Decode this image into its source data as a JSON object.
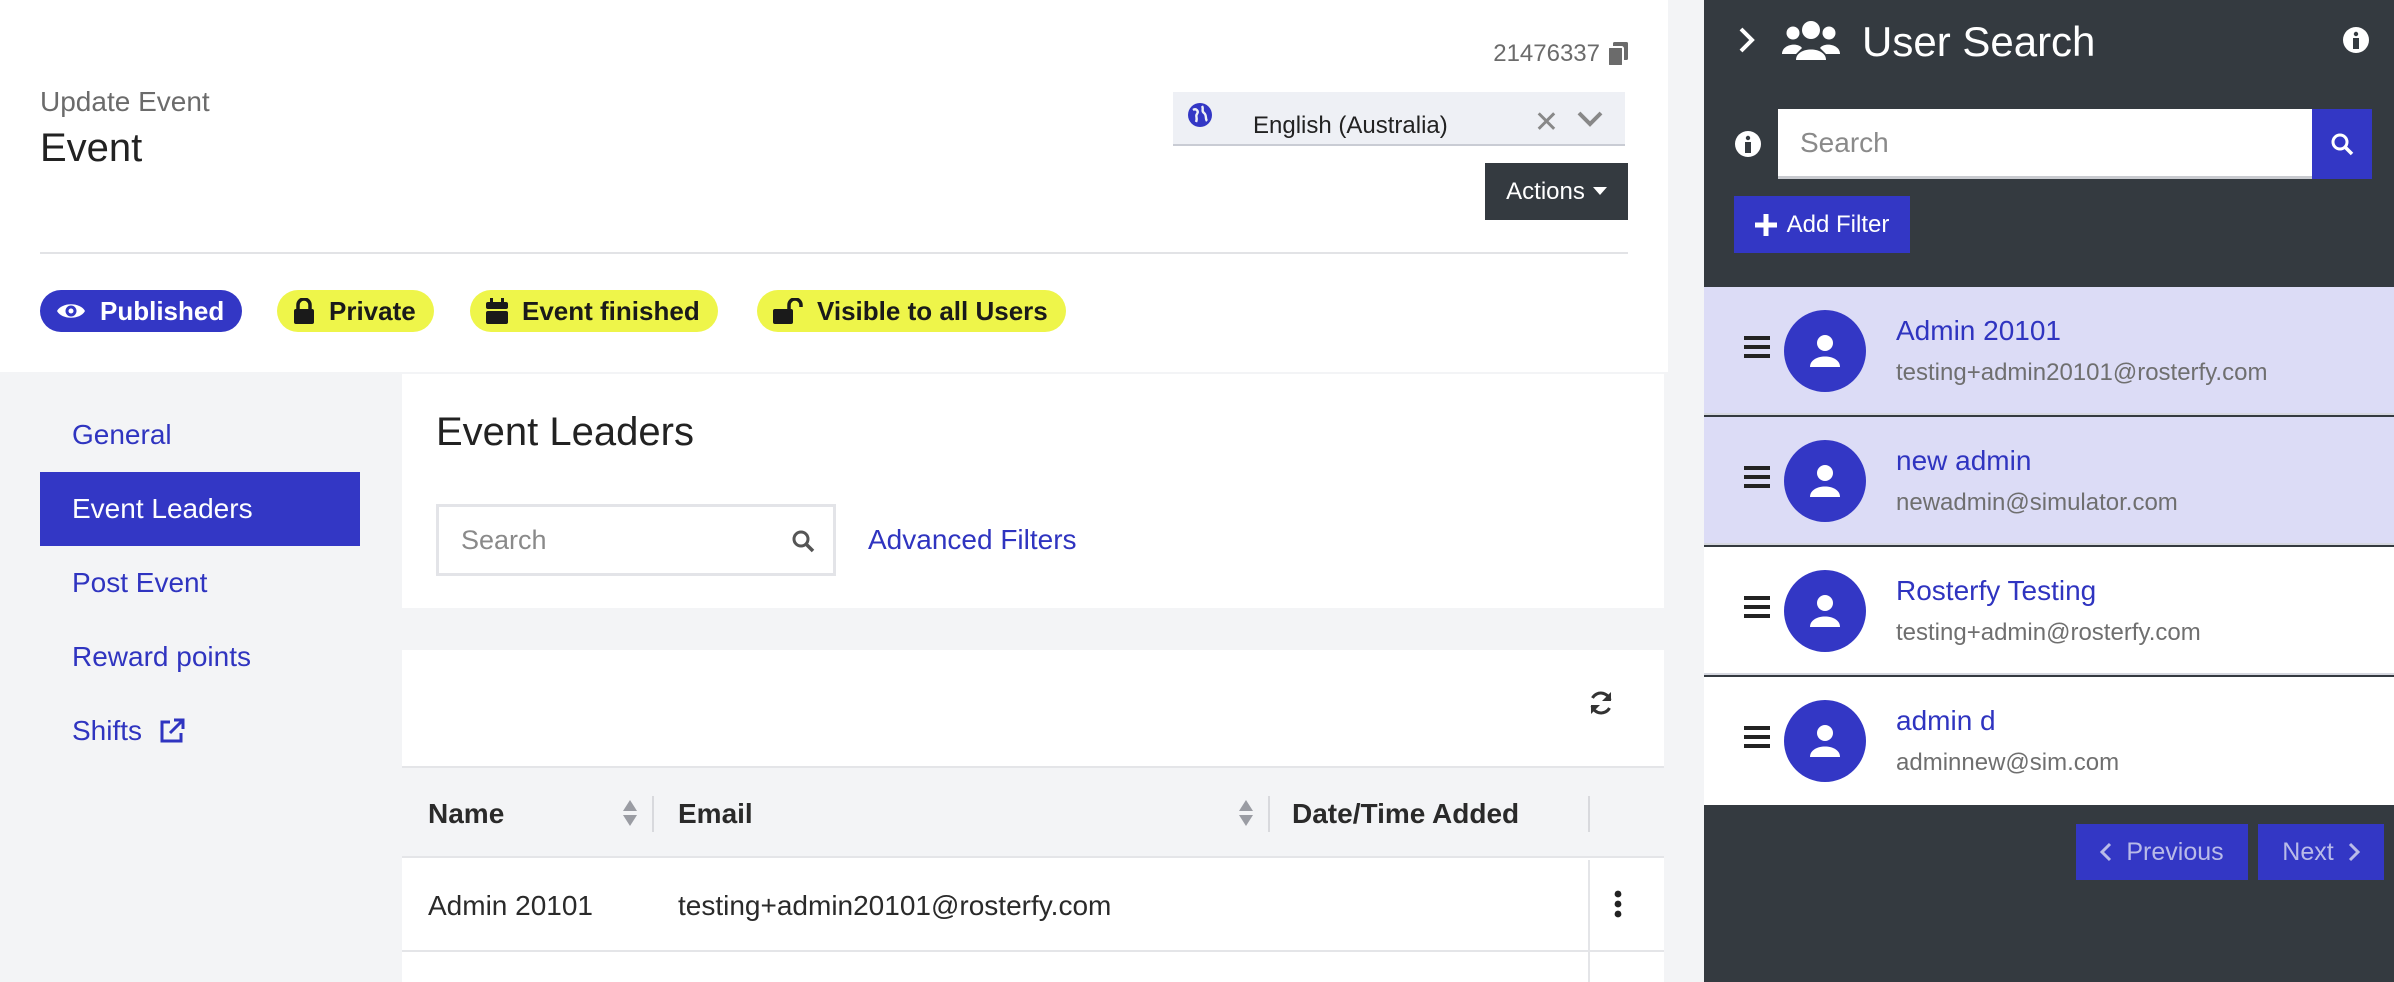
{
  "header": {
    "event_id": "21476337",
    "subtitle": "Update Event",
    "title": "Event",
    "language": "English (Australia)",
    "actions_label": "Actions"
  },
  "badges": [
    {
      "label": "Published",
      "icon": "eye-icon",
      "color": "#3337c5"
    },
    {
      "label": "Private",
      "icon": "lock-icon",
      "color": "#eef54a"
    },
    {
      "label": "Event finished",
      "icon": "calendar-icon",
      "color": "#eef54a"
    },
    {
      "label": "Visible to all Users",
      "icon": "unlock-icon",
      "color": "#eef54a"
    }
  ],
  "sidebar": {
    "items": [
      {
        "label": "General",
        "active": false
      },
      {
        "label": "Event Leaders",
        "active": true
      },
      {
        "label": "Post Event",
        "active": false
      },
      {
        "label": "Reward points",
        "active": false
      },
      {
        "label": "Shifts",
        "active": false,
        "icon": "external-link-icon"
      }
    ]
  },
  "leaders": {
    "heading": "Event Leaders",
    "search_placeholder": "Search",
    "advanced_filters": "Advanced Filters",
    "table": {
      "columns": [
        "Name",
        "Email",
        "Date/Time Added"
      ],
      "rows": [
        {
          "name": "Admin 20101",
          "email": "testing+admin20101@rosterfy.com",
          "added": ""
        }
      ]
    }
  },
  "user_search": {
    "title": "User Search",
    "search_placeholder": "Search",
    "add_filter_label": "Add Filter",
    "users": [
      {
        "name": "Admin 20101",
        "email": "testing+admin20101@rosterfy.com",
        "selected": true
      },
      {
        "name": "new admin",
        "email": "newadmin@simulator.com",
        "selected": true
      },
      {
        "name": "Rosterfy Testing",
        "email": "testing+admin@rosterfy.com",
        "selected": false
      },
      {
        "name": "admin d",
        "email": "adminnew@sim.com",
        "selected": false
      }
    ],
    "pagination": {
      "previous": "Previous",
      "next": "Next"
    }
  },
  "colors": {
    "accent": "#3337c5",
    "badge_yellow": "#eef54a",
    "panel_dark": "#343a40",
    "selected_row": "#dcdcf6"
  }
}
